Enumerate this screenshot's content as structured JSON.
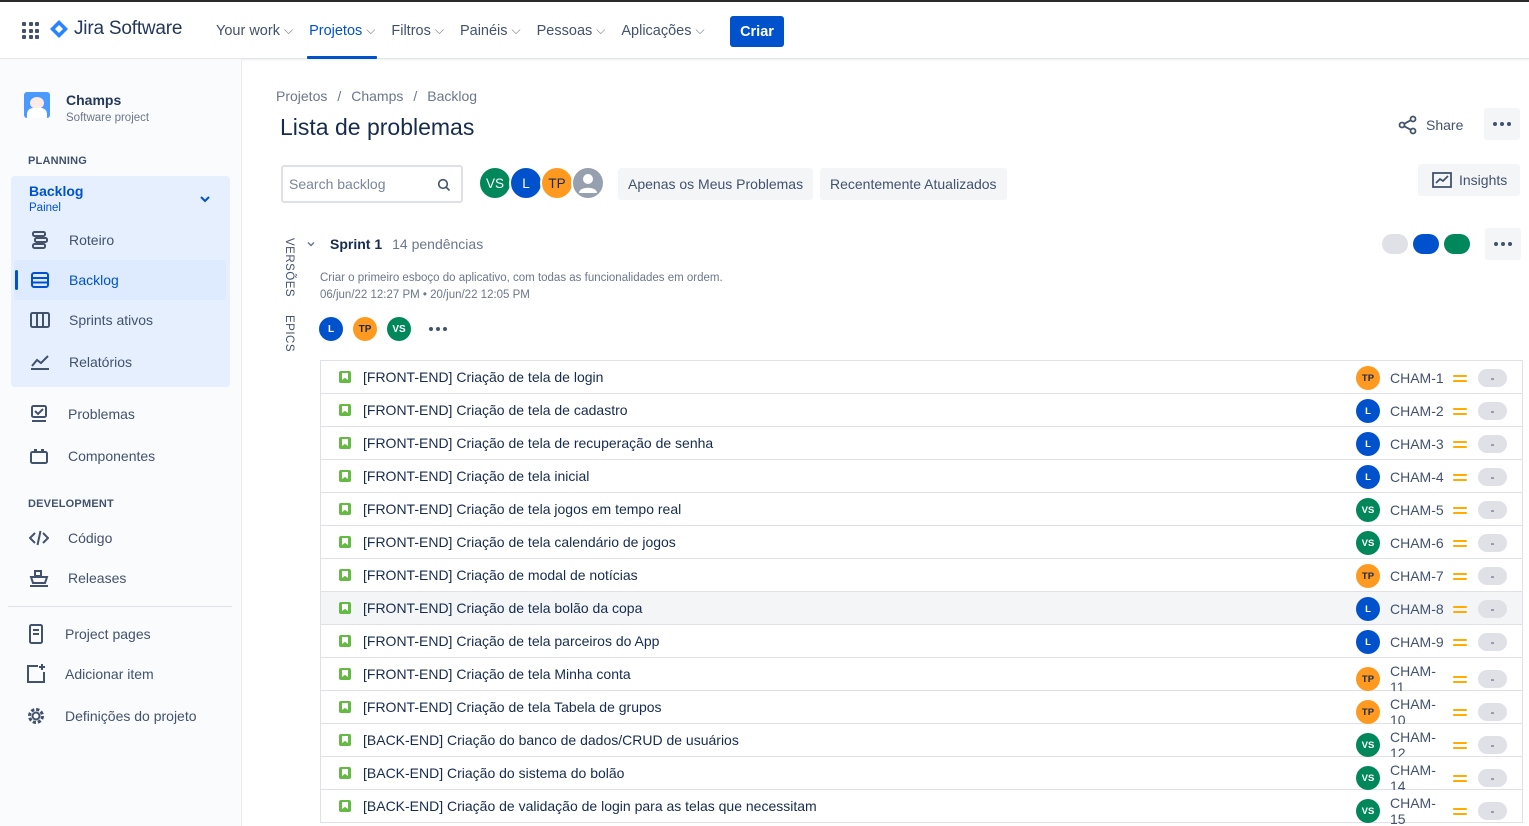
{
  "topnav": {
    "logo": "Jira Software",
    "items": [
      {
        "label": "Your work",
        "active": false
      },
      {
        "label": "Projetos",
        "active": true
      },
      {
        "label": "Filtros",
        "active": false
      },
      {
        "label": "Painéis",
        "active": false
      },
      {
        "label": "Pessoas",
        "active": false
      },
      {
        "label": "Aplicações",
        "active": false
      }
    ],
    "create_label": "Criar"
  },
  "sidebar": {
    "project_name": "Champs",
    "project_type": "Software project",
    "planning_label": "PLANNING",
    "planning_title": "Backlog",
    "planning_sub": "Painel",
    "planning_items": [
      "Roteiro",
      "Backlog",
      "Sprints ativos",
      "Relatórios"
    ],
    "other_items": [
      "Problemas",
      "Componentes"
    ],
    "development_label": "DEVELOPMENT",
    "development_items": [
      "Código",
      "Releases"
    ],
    "footer_items": [
      "Project pages",
      "Adicionar item",
      "Definições do projeto"
    ]
  },
  "breadcrumb": [
    "Projetos",
    "Champs",
    "Backlog"
  ],
  "page_title": "Lista de problemas",
  "share_label": "Share",
  "search": {
    "placeholder": "Search backlog"
  },
  "filter_avatars": [
    "VS",
    "L",
    "TP"
  ],
  "filters": [
    "Apenas os Meus Problemas",
    "Recentemente Atualizados"
  ],
  "insights_label": "Insights",
  "side_tabs": [
    "VERSÕES",
    "EPICS"
  ],
  "sprint": {
    "name": "Sprint 1",
    "count": "14 pendências",
    "goal": "Criar o primeiro esboço do aplicativo, com todas as funcionalidades em ordem.",
    "dates": "06/jun/22 12:27 PM • 20/jun/22 12:05 PM",
    "assignees": [
      "L",
      "TP",
      "VS"
    ],
    "status_colors": [
      "#DFE1E6",
      "#0052CC",
      "#00875A"
    ]
  },
  "issues": [
    {
      "summary": "[FRONT-END] Criação de tela de login",
      "assignee": "TP",
      "key": "CHAM-1",
      "estimate": "-"
    },
    {
      "summary": "[FRONT-END] Criação de tela de cadastro",
      "assignee": "L",
      "key": "CHAM-2",
      "estimate": "-"
    },
    {
      "summary": "[FRONT-END] Criação de tela de recuperação de senha",
      "assignee": "L",
      "key": "CHAM-3",
      "estimate": "-"
    },
    {
      "summary": "[FRONT-END] Criação de tela inicial",
      "assignee": "L",
      "key": "CHAM-4",
      "estimate": "-"
    },
    {
      "summary": "[FRONT-END] Criação de tela jogos em tempo real",
      "assignee": "VS",
      "key": "CHAM-5",
      "estimate": "-"
    },
    {
      "summary": "[FRONT-END] Criação de tela calendário de jogos",
      "assignee": "VS",
      "key": "CHAM-6",
      "estimate": "-"
    },
    {
      "summary": "[FRONT-END] Criação de modal de notícias",
      "assignee": "TP",
      "key": "CHAM-7",
      "estimate": "-"
    },
    {
      "summary": "[FRONT-END] Criação de tela bolão da copa",
      "assignee": "L",
      "key": "CHAM-8",
      "estimate": "-"
    },
    {
      "summary": "[FRONT-END] Criação de tela parceiros do App",
      "assignee": "L",
      "key": "CHAM-9",
      "estimate": "-"
    },
    {
      "summary": "[FRONT-END] Criação de tela Minha conta",
      "assignee": "TP",
      "key": "CHAM-11",
      "estimate": "-"
    },
    {
      "summary": "[FRONT-END] Criação de tela Tabela de grupos",
      "assignee": "TP",
      "key": "CHAM-10",
      "estimate": "-"
    },
    {
      "summary": "[BACK-END] Criação do banco de dados/CRUD de usuários",
      "assignee": "VS",
      "key": "CHAM-12",
      "estimate": "-"
    },
    {
      "summary": "[BACK-END] Criação do sistema do bolão",
      "assignee": "VS",
      "key": "CHAM-14",
      "estimate": "-"
    },
    {
      "summary": "[BACK-END] Criação de validação de login para as telas que necessitam",
      "assignee": "VS",
      "key": "CHAM-15",
      "estimate": "-"
    }
  ]
}
